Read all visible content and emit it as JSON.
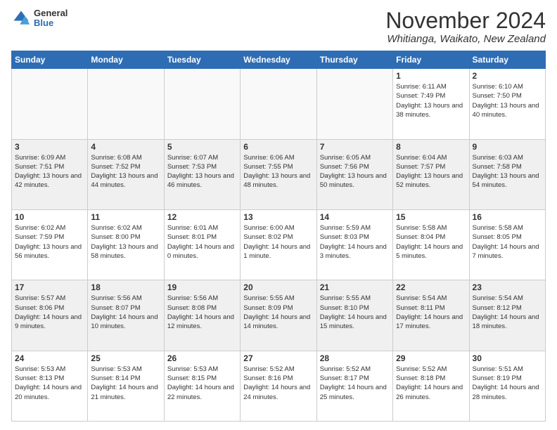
{
  "header": {
    "logo": {
      "general": "General",
      "blue": "Blue"
    },
    "title": "November 2024",
    "location": "Whitianga, Waikato, New Zealand"
  },
  "weekdays": [
    "Sunday",
    "Monday",
    "Tuesday",
    "Wednesday",
    "Thursday",
    "Friday",
    "Saturday"
  ],
  "weeks": [
    [
      {
        "day": "",
        "info": ""
      },
      {
        "day": "",
        "info": ""
      },
      {
        "day": "",
        "info": ""
      },
      {
        "day": "",
        "info": ""
      },
      {
        "day": "",
        "info": ""
      },
      {
        "day": "1",
        "info": "Sunrise: 6:11 AM\nSunset: 7:49 PM\nDaylight: 13 hours and 38 minutes."
      },
      {
        "day": "2",
        "info": "Sunrise: 6:10 AM\nSunset: 7:50 PM\nDaylight: 13 hours and 40 minutes."
      }
    ],
    [
      {
        "day": "3",
        "info": "Sunrise: 6:09 AM\nSunset: 7:51 PM\nDaylight: 13 hours and 42 minutes."
      },
      {
        "day": "4",
        "info": "Sunrise: 6:08 AM\nSunset: 7:52 PM\nDaylight: 13 hours and 44 minutes."
      },
      {
        "day": "5",
        "info": "Sunrise: 6:07 AM\nSunset: 7:53 PM\nDaylight: 13 hours and 46 minutes."
      },
      {
        "day": "6",
        "info": "Sunrise: 6:06 AM\nSunset: 7:55 PM\nDaylight: 13 hours and 48 minutes."
      },
      {
        "day": "7",
        "info": "Sunrise: 6:05 AM\nSunset: 7:56 PM\nDaylight: 13 hours and 50 minutes."
      },
      {
        "day": "8",
        "info": "Sunrise: 6:04 AM\nSunset: 7:57 PM\nDaylight: 13 hours and 52 minutes."
      },
      {
        "day": "9",
        "info": "Sunrise: 6:03 AM\nSunset: 7:58 PM\nDaylight: 13 hours and 54 minutes."
      }
    ],
    [
      {
        "day": "10",
        "info": "Sunrise: 6:02 AM\nSunset: 7:59 PM\nDaylight: 13 hours and 56 minutes."
      },
      {
        "day": "11",
        "info": "Sunrise: 6:02 AM\nSunset: 8:00 PM\nDaylight: 13 hours and 58 minutes."
      },
      {
        "day": "12",
        "info": "Sunrise: 6:01 AM\nSunset: 8:01 PM\nDaylight: 14 hours and 0 minutes."
      },
      {
        "day": "13",
        "info": "Sunrise: 6:00 AM\nSunset: 8:02 PM\nDaylight: 14 hours and 1 minute."
      },
      {
        "day": "14",
        "info": "Sunrise: 5:59 AM\nSunset: 8:03 PM\nDaylight: 14 hours and 3 minutes."
      },
      {
        "day": "15",
        "info": "Sunrise: 5:58 AM\nSunset: 8:04 PM\nDaylight: 14 hours and 5 minutes."
      },
      {
        "day": "16",
        "info": "Sunrise: 5:58 AM\nSunset: 8:05 PM\nDaylight: 14 hours and 7 minutes."
      }
    ],
    [
      {
        "day": "17",
        "info": "Sunrise: 5:57 AM\nSunset: 8:06 PM\nDaylight: 14 hours and 9 minutes."
      },
      {
        "day": "18",
        "info": "Sunrise: 5:56 AM\nSunset: 8:07 PM\nDaylight: 14 hours and 10 minutes."
      },
      {
        "day": "19",
        "info": "Sunrise: 5:56 AM\nSunset: 8:08 PM\nDaylight: 14 hours and 12 minutes."
      },
      {
        "day": "20",
        "info": "Sunrise: 5:55 AM\nSunset: 8:09 PM\nDaylight: 14 hours and 14 minutes."
      },
      {
        "day": "21",
        "info": "Sunrise: 5:55 AM\nSunset: 8:10 PM\nDaylight: 14 hours and 15 minutes."
      },
      {
        "day": "22",
        "info": "Sunrise: 5:54 AM\nSunset: 8:11 PM\nDaylight: 14 hours and 17 minutes."
      },
      {
        "day": "23",
        "info": "Sunrise: 5:54 AM\nSunset: 8:12 PM\nDaylight: 14 hours and 18 minutes."
      }
    ],
    [
      {
        "day": "24",
        "info": "Sunrise: 5:53 AM\nSunset: 8:13 PM\nDaylight: 14 hours and 20 minutes."
      },
      {
        "day": "25",
        "info": "Sunrise: 5:53 AM\nSunset: 8:14 PM\nDaylight: 14 hours and 21 minutes."
      },
      {
        "day": "26",
        "info": "Sunrise: 5:53 AM\nSunset: 8:15 PM\nDaylight: 14 hours and 22 minutes."
      },
      {
        "day": "27",
        "info": "Sunrise: 5:52 AM\nSunset: 8:16 PM\nDaylight: 14 hours and 24 minutes."
      },
      {
        "day": "28",
        "info": "Sunrise: 5:52 AM\nSunset: 8:17 PM\nDaylight: 14 hours and 25 minutes."
      },
      {
        "day": "29",
        "info": "Sunrise: 5:52 AM\nSunset: 8:18 PM\nDaylight: 14 hours and 26 minutes."
      },
      {
        "day": "30",
        "info": "Sunrise: 5:51 AM\nSunset: 8:19 PM\nDaylight: 14 hours and 28 minutes."
      }
    ]
  ]
}
